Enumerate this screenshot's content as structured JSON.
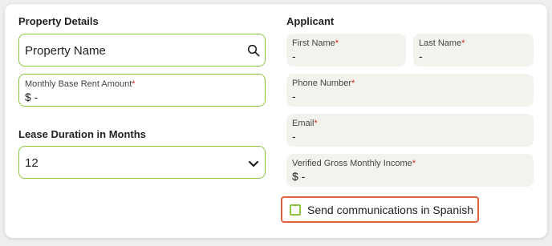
{
  "property": {
    "section_title": "Property Details",
    "property_name_placeholder": "Property Name",
    "rent_label": "Monthly Base Rent Amount",
    "rent_value": "$ -",
    "required_mark": "*"
  },
  "lease": {
    "section_title": "Lease Duration in Months",
    "value": "12"
  },
  "applicant": {
    "section_title": "Applicant",
    "first_name_label": "First Name",
    "first_name_value": "-",
    "last_name_label": "Last Name",
    "last_name_value": "-",
    "phone_label": "Phone Number",
    "phone_value": "-",
    "email_label": "Email",
    "email_value": "-",
    "income_label": "Verified Gross Monthly Income",
    "income_value": "$ -",
    "required_mark": "*"
  },
  "spanish_option": {
    "label": "Send communications in Spanish",
    "checked": false
  },
  "colors": {
    "accent_green": "#8cc63f",
    "highlight_orange": "#e2623f",
    "required_red": "#d0241b",
    "field_grey": "#f3f3ee"
  },
  "icons": {
    "search": "search-icon",
    "dropdown": "chevron-down-icon"
  }
}
